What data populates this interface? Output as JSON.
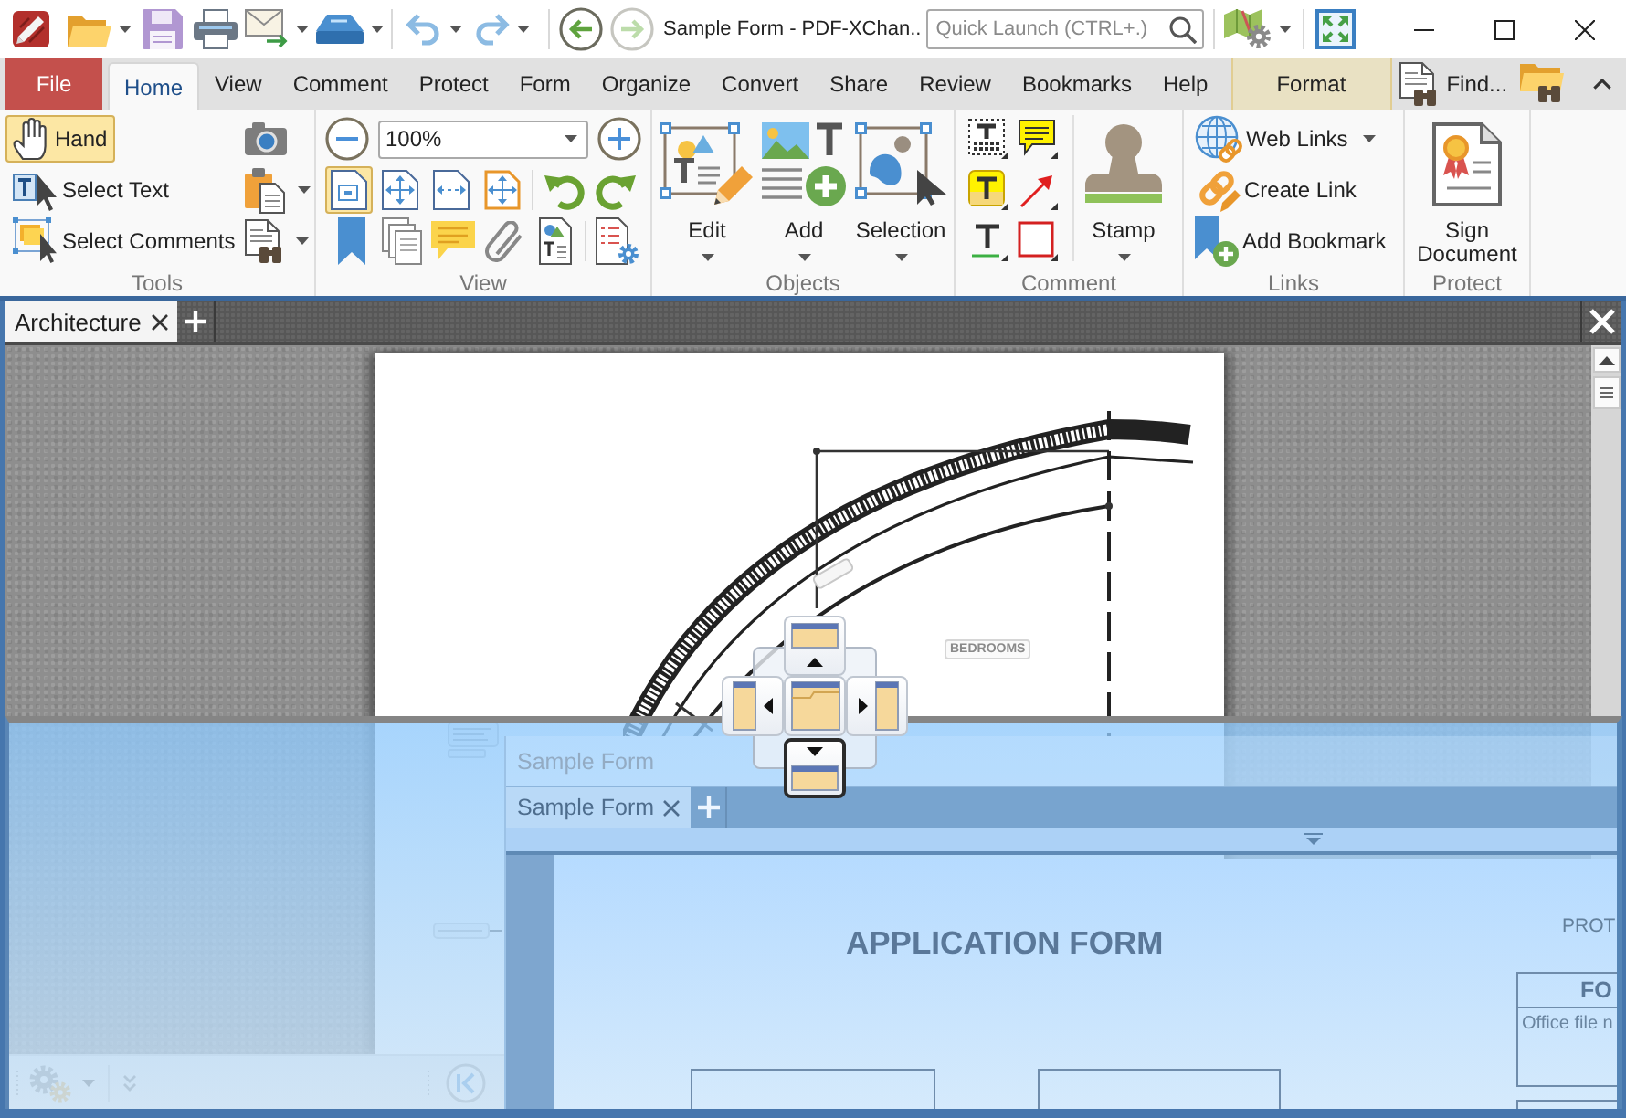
{
  "title_bar": {
    "title": "Sample Form - PDF-XChan..",
    "quick_launch": {
      "placeholder": "Quick Launch (CTRL+.)"
    },
    "nav_buttons": [
      {
        "kind": "back",
        "disabled": false
      },
      {
        "kind": "forward",
        "disabled": true
      }
    ]
  },
  "ribbon_tabs": [
    {
      "label": "File",
      "kind": "file",
      "selected": false
    },
    {
      "label": "Home",
      "kind": "tab",
      "selected": true
    },
    {
      "label": "View",
      "kind": "tab",
      "selected": false
    },
    {
      "label": "Comment",
      "kind": "tab",
      "selected": false
    },
    {
      "label": "Protect",
      "kind": "tab",
      "selected": false
    },
    {
      "label": "Form",
      "kind": "tab",
      "selected": false
    },
    {
      "label": "Organize",
      "kind": "tab",
      "selected": false
    },
    {
      "label": "Convert",
      "kind": "tab",
      "selected": false
    },
    {
      "label": "Share",
      "kind": "tab",
      "selected": false
    },
    {
      "label": "Review",
      "kind": "tab",
      "selected": false
    },
    {
      "label": "Bookmarks",
      "kind": "tab",
      "selected": false
    },
    {
      "label": "Help",
      "kind": "tab",
      "selected": false
    },
    {
      "label": "Format",
      "kind": "contextual",
      "selected": false
    }
  ],
  "find": {
    "label": "Find..."
  },
  "ribbon_groups": [
    {
      "kind": "tools",
      "title": "Tools",
      "tools": [
        {
          "label": "Hand",
          "selected": true
        },
        {
          "label": "Select Text",
          "selected": false
        },
        {
          "label": "Select Comments",
          "selected": false
        }
      ]
    },
    {
      "kind": "view",
      "title": "View",
      "zoom": {
        "value": "100%"
      },
      "page_views": [
        {
          "selected": true
        },
        {
          "selected": false
        },
        {
          "selected": false
        },
        {
          "selected": false
        }
      ]
    },
    {
      "kind": "objects",
      "title": "Objects",
      "buttons": [
        "Edit",
        "Add",
        "Selection"
      ]
    },
    {
      "kind": "comment",
      "title": "Comment",
      "buttons": [
        "Stamp"
      ]
    },
    {
      "kind": "links",
      "title": "Links",
      "buttons": [
        "Web Links",
        "Create Link",
        "Add Bookmark"
      ]
    },
    {
      "kind": "protect",
      "title": "Protect",
      "buttons": [
        "Sign Document"
      ]
    }
  ],
  "document": {
    "tabs": [
      {
        "label": "Architecture",
        "selected": true
      }
    ],
    "page": {
      "room_label": "BEDROOMS"
    }
  },
  "dock_guide": {
    "buttons": [
      {
        "kind": "top",
        "selected": false
      },
      {
        "kind": "left",
        "selected": false
      },
      {
        "kind": "center",
        "selected": false
      },
      {
        "kind": "right",
        "selected": false
      },
      {
        "kind": "bottom",
        "selected": true
      }
    ]
  },
  "dragged_window": {
    "title": "Sample Form",
    "tabs": [
      {
        "label": "Sample Form",
        "selected": true
      }
    ],
    "page": {
      "heading": "APPLICATION FORM",
      "corner_text": "PROT",
      "table": {
        "header": "FO",
        "field_label": "Office file n"
      }
    }
  }
}
